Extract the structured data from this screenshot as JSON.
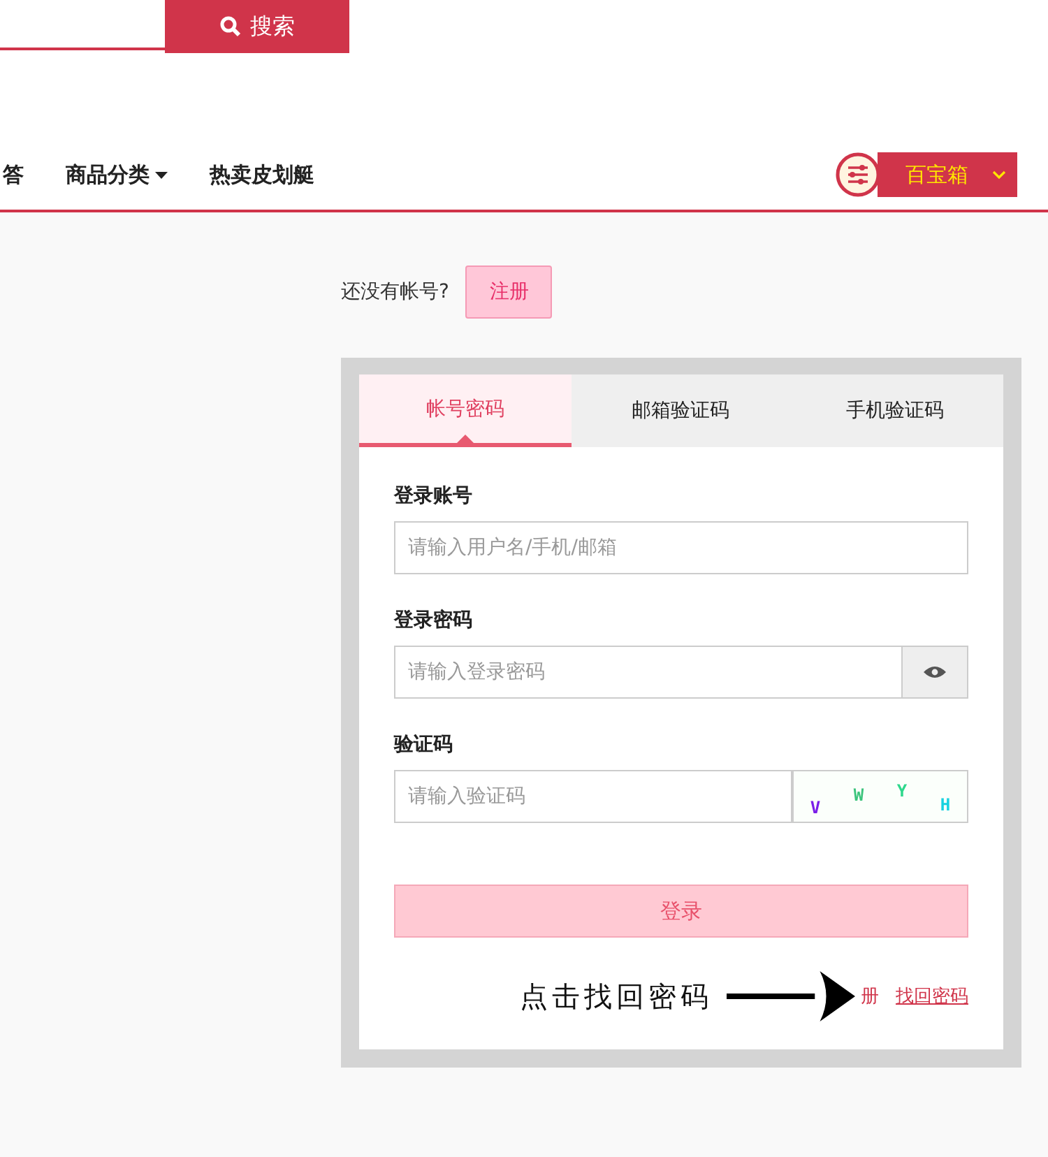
{
  "search": {
    "button": "搜索"
  },
  "nav": {
    "items": [
      {
        "label": "答",
        "dropdown": false
      },
      {
        "label": "商品分类",
        "dropdown": true
      },
      {
        "label": "热卖皮划艇",
        "dropdown": false
      }
    ],
    "toolbox": "百宝箱"
  },
  "register": {
    "prompt": "还没有帐号?",
    "button": "注册"
  },
  "tabs": [
    {
      "label": "帐号密码",
      "selected": true
    },
    {
      "label": "邮箱验证码",
      "selected": false
    },
    {
      "label": "手机验证码",
      "selected": false
    }
  ],
  "fields": [
    {
      "label": "登录账号",
      "placeholder": "请输入用户名/手机/邮箱",
      "kind": "text"
    },
    {
      "label": "登录密码",
      "placeholder": "请输入登录密码",
      "kind": "password"
    },
    {
      "label": "验证码",
      "placeholder": "请输入验证码",
      "kind": "captcha"
    }
  ],
  "captcha": [
    {
      "char": "V",
      "color": "#7a1ee8"
    },
    {
      "char": "W",
      "color": "#3cc47c"
    },
    {
      "char": "Y",
      "color": "#2ed88c"
    },
    {
      "char": "H",
      "color": "#18d2e0"
    }
  ],
  "login_button": "登录",
  "footer_links": [
    "册",
    "找回密码"
  ],
  "annotation": "点击找回密码"
}
